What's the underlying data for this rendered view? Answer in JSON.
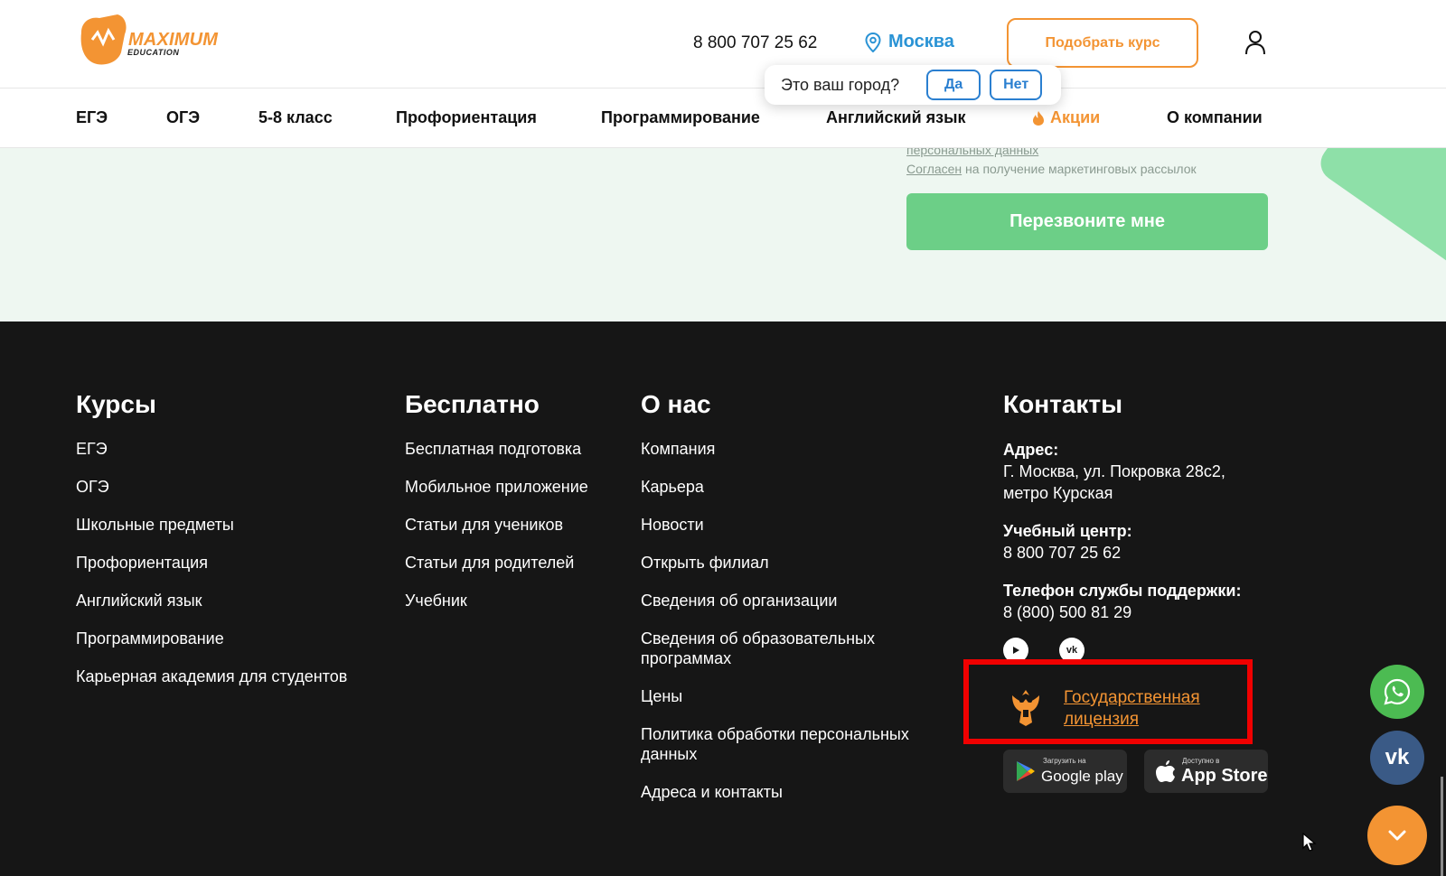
{
  "header": {
    "logo": {
      "name": "MAXIMUM",
      "sub": "EDUCATION"
    },
    "phone": "8 800 707 25 62",
    "city": "Москва",
    "pick_course_label": "Подобрать курс",
    "city_popup": {
      "question": "Это ваш город?",
      "yes_label": "Да",
      "no_label": "Нет"
    }
  },
  "nav": {
    "items": [
      "ЕГЭ",
      "ОГЭ",
      "5-8 класс",
      "Профориентация",
      "Программирование",
      "Английский язык",
      "Акции",
      "О компании"
    ]
  },
  "callback": {
    "consent_personal": "персональных данных",
    "consent_marketing_link": "Согласен",
    "consent_marketing_rest": " на получение маркетинговых рассылок",
    "button_label": "Перезвоните мне"
  },
  "footer": {
    "courses": {
      "title": "Курсы",
      "items": [
        "ЕГЭ",
        "ОГЭ",
        "Школьные предметы",
        "Профориентация",
        "Английский язык",
        "Программирование",
        "Карьерная академия для студентов"
      ]
    },
    "free": {
      "title": "Бесплатно",
      "items": [
        "Бесплатная подготовка",
        "Мобильное приложение",
        "Статьи для учеников",
        "Статьи для родителей",
        "Учебник"
      ]
    },
    "about": {
      "title": "О нас",
      "items": [
        "Компания",
        "Карьера",
        "Новости",
        "Открыть филиал",
        "Сведения об организации",
        "Сведения об образовательных программах",
        "Цены",
        "Политика обработки персональных данных",
        "Адреса и контакты"
      ]
    },
    "contacts": {
      "title": "Контакты",
      "address_label": "Адрес:",
      "address_line1": "Г. Москва, ул. Покровка 28с2,",
      "address_line2": "метро Курская",
      "center_label": "Учебный центр:",
      "center_phone": "8 800 707 25 62",
      "support_label": "Телефон службы поддержки:",
      "support_phone": "8 (800) 500 81 29",
      "license_line1": "Государственная",
      "license_line2": "лицензия"
    },
    "stores": {
      "google_small": "Загрузить на",
      "google_big": "Google play",
      "apple_small": "Доступно в",
      "apple_big": "App Store"
    }
  },
  "colors": {
    "accent_orange": "#f39433",
    "city_blue": "#2a93d5",
    "callback_green": "#6ccf87",
    "footer_bg": "#161616",
    "highlight_red": "#f00000"
  }
}
